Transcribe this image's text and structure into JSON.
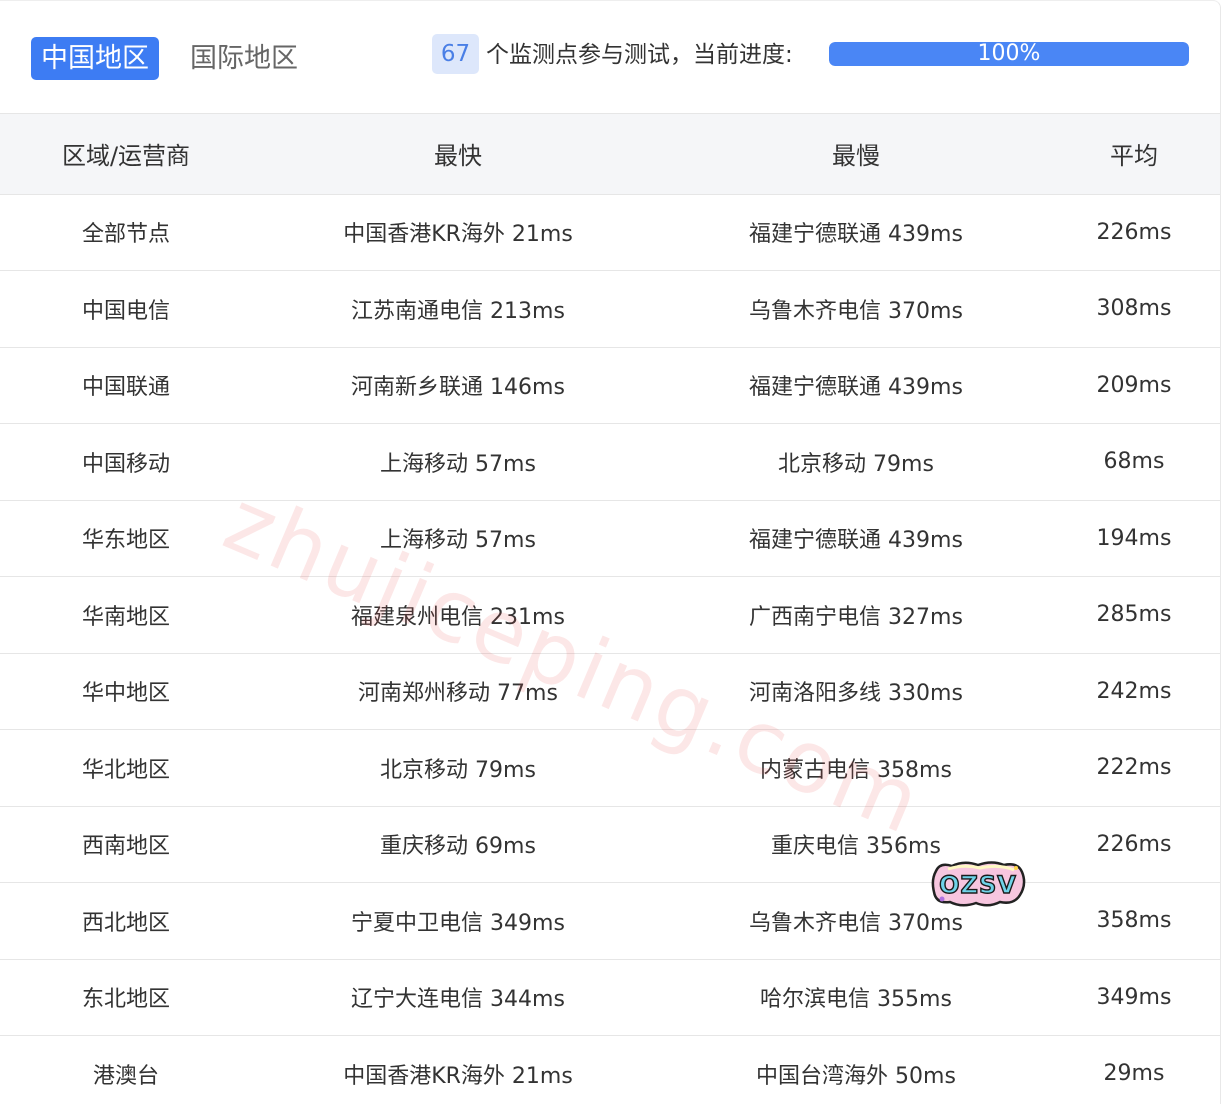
{
  "tabs": [
    {
      "label": "中国地区",
      "active": true
    },
    {
      "label": "国际地区",
      "active": false
    }
  ],
  "monitor": {
    "count": "67",
    "text": "个监测点参与测试，当前进度:",
    "progress_label": "100%",
    "progress": 1.0
  },
  "table": {
    "headers": [
      "区域/运营商",
      "最快",
      "最慢",
      "平均"
    ],
    "rows": [
      [
        "全部节点",
        "中国香港KR海外 21ms",
        "福建宁德联通 439ms",
        "226ms"
      ],
      [
        "中国电信",
        "江苏南通电信 213ms",
        "乌鲁木齐电信 370ms",
        "308ms"
      ],
      [
        "中国联通",
        "河南新乡联通 146ms",
        "福建宁德联通 439ms",
        "209ms"
      ],
      [
        "中国移动",
        "上海移动 57ms",
        "北京移动 79ms",
        "68ms"
      ],
      [
        "华东地区",
        "上海移动 57ms",
        "福建宁德联通 439ms",
        "194ms"
      ],
      [
        "华南地区",
        "福建泉州电信 231ms",
        "广西南宁电信 327ms",
        "285ms"
      ],
      [
        "华中地区",
        "河南郑州移动 77ms",
        "河南洛阳多线 330ms",
        "242ms"
      ],
      [
        "华北地区",
        "北京移动 79ms",
        "内蒙古电信 358ms",
        "222ms"
      ],
      [
        "西南地区",
        "重庆移动 69ms",
        "重庆电信 356ms",
        "226ms"
      ],
      [
        "西北地区",
        "宁夏中卫电信 349ms",
        "乌鲁木齐电信 370ms",
        "358ms"
      ],
      [
        "东北地区",
        "辽宁大连电信 344ms",
        "哈尔滨电信 355ms",
        "349ms"
      ],
      [
        "港澳台",
        "中国香港KR海外 21ms",
        "中国台湾海外 50ms",
        "29ms"
      ]
    ]
  },
  "watermark": "zhujiceping.com",
  "sticker": "OZSV",
  "colors": {
    "accent": "#3d7cf3",
    "badge_bg": "#dde7fb",
    "badge_text": "#4a7fe6",
    "progress_fill": "#4a86f5",
    "header_bg": "#f5f6f8"
  }
}
